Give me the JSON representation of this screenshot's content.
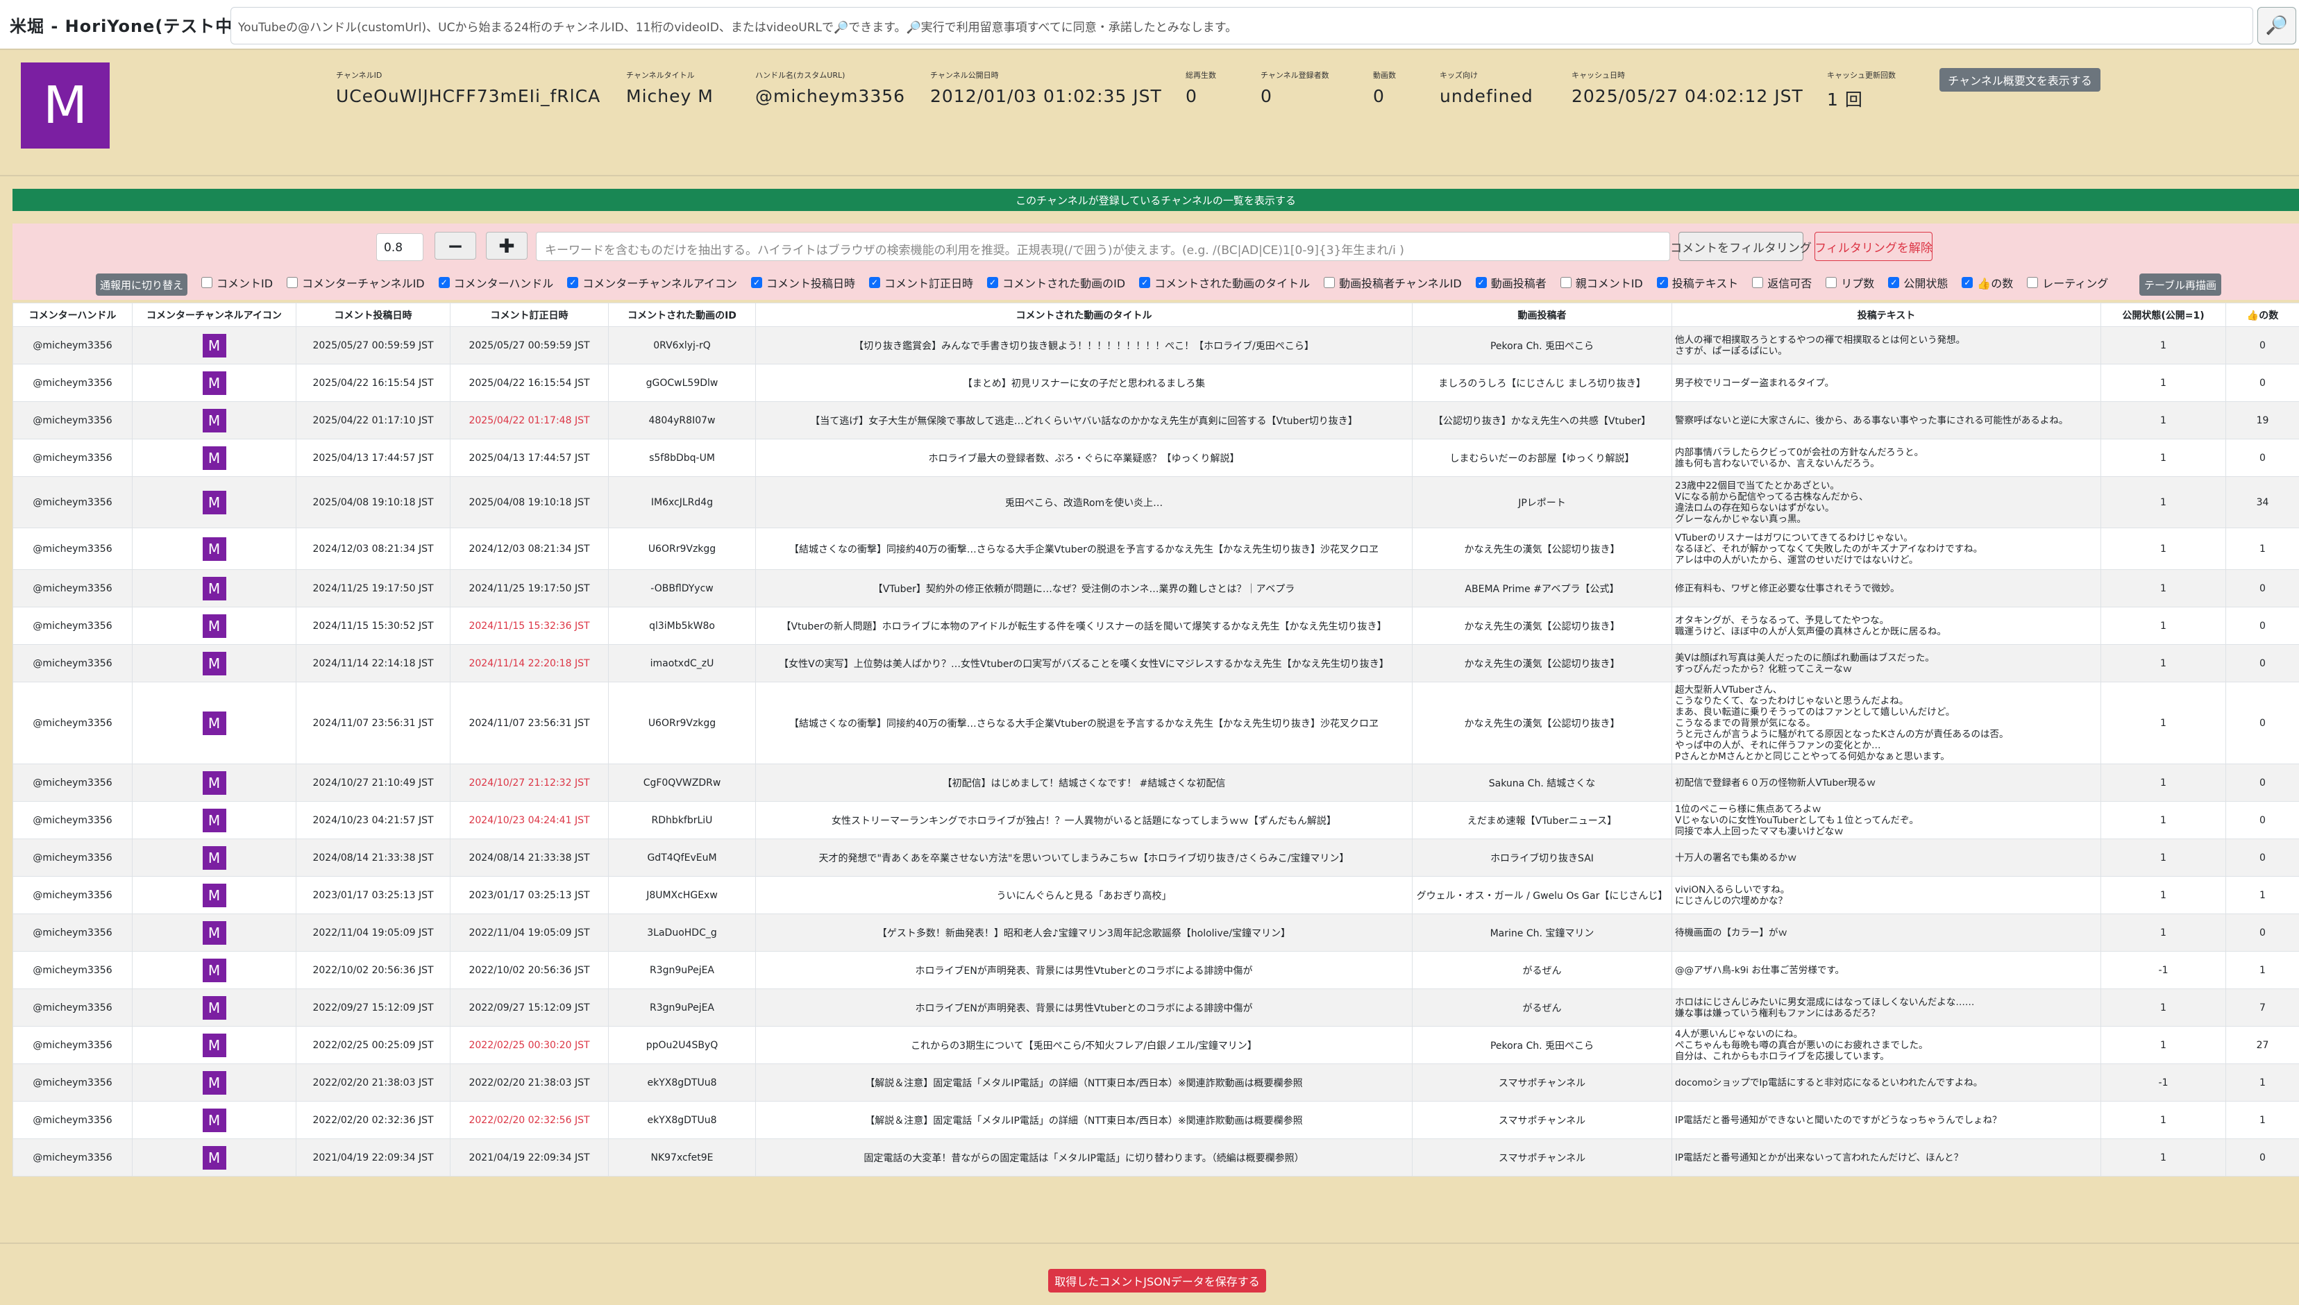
{
  "app_title": "米堀 - HoriYone(テスト中)",
  "search": {
    "text": "YouTubeの@ハンドル(customUrl)、UCから始まる24桁のチャンネルID、11桁のvideoID、またはvideoURLで🔎できます。🔎実行で利用留意事項すべてに同意・承諾したとみなします。",
    "btn": "🔎"
  },
  "channel": {
    "avatar_letter": "M",
    "fields": [
      {
        "label": "チャンネルID",
        "value": "UCeOuWlJHCFF73mEIi_fRlCA"
      },
      {
        "label": "チャンネルタイトル",
        "value": "Michey M"
      },
      {
        "label": "ハンドル名(カスタムURL)",
        "value": "@micheym3356"
      },
      {
        "label": "チャンネル公開日時",
        "value": "2012/01/03 01:02:35 JST"
      },
      {
        "label": "総再生数",
        "value": "0"
      },
      {
        "label": "チャンネル登録者数",
        "value": "0"
      },
      {
        "label": "動画数",
        "value": "0"
      },
      {
        "label": "キッズ向け",
        "value": "undefined"
      },
      {
        "label": "キャッシュ日時",
        "value": "2025/05/27 04:02:12 JST"
      },
      {
        "label": "キャッシュ更新回数",
        "value": "1 回"
      }
    ],
    "desc_btn": "チャンネル概要文を表示する"
  },
  "subs_bar": "このチャンネルが登録しているチャンネルの一覧を表示する",
  "filter": {
    "zoom": "0.8",
    "minus": "−",
    "plus": "✚",
    "keyword_placeholder": "キーワードを含むものだけを抽出する。ハイライトはブラウザの検索機能の利用を推奨。正規表現(/で囲う)が使えます。(e.g. /(BC|AD|CE)1[0-9]{3}年生まれ/i )",
    "apply": "コメントをフィルタリング",
    "clear": "フィルタリングを解除",
    "mode_btn": "通報用に切り替え",
    "redraw": "テーブル再描画",
    "columns": [
      {
        "label": "コメントID",
        "on": false
      },
      {
        "label": "コメンターチャンネルID",
        "on": false
      },
      {
        "label": "コメンターハンドル",
        "on": true
      },
      {
        "label": "コメンターチャンネルアイコン",
        "on": true
      },
      {
        "label": "コメント投稿日時",
        "on": true
      },
      {
        "label": "コメント訂正日時",
        "on": true
      },
      {
        "label": "コメントされた動画のID",
        "on": true
      },
      {
        "label": "コメントされた動画のタイトル",
        "on": true
      },
      {
        "label": "動画投稿者チャンネルID",
        "on": false
      },
      {
        "label": "動画投稿者",
        "on": true
      },
      {
        "label": "親コメントID",
        "on": false
      },
      {
        "label": "投稿テキスト",
        "on": true
      },
      {
        "label": "返信可否",
        "on": false
      },
      {
        "label": "リプ数",
        "on": false
      },
      {
        "label": "公開状態",
        "on": true
      },
      {
        "label": "👍の数",
        "on": true
      },
      {
        "label": "レーティング",
        "on": false
      }
    ]
  },
  "table": {
    "headers": [
      "コメンターハンドル",
      "コメンターチャンネルアイコン",
      "コメント投稿日時",
      "コメント訂正日時",
      "コメントされた動画のID",
      "コメントされた動画のタイトル",
      "動画投稿者",
      "投稿テキスト",
      "公開状態(公開=1)",
      "👍の数"
    ],
    "rows": [
      {
        "h": "@micheym3356",
        "a": "M",
        "p": "2025/05/27 00:59:59 JST",
        "e": "2025/05/27 00:59:59 JST",
        "er": false,
        "v": "0RV6xlyj-rQ",
        "t": "【切り抜き鑑賞会】みんなで手書き切り抜き観よう！！！！！！！！！ぺこ！【ホロライブ/兎田ぺこら】",
        "o": "Pekora Ch. 兎田ぺこら",
        "x": "他人の褌で相撲取ろうとするやつの褌で相撲取るとは何という発想。\nさすが、ぱーぽるぱにい。",
        "s": "1",
        "l": "0"
      },
      {
        "h": "@micheym3356",
        "a": "M",
        "p": "2025/04/22 16:15:54 JST",
        "e": "2025/04/22 16:15:54 JST",
        "er": false,
        "v": "gGOCwL59Dlw",
        "t": "【まとめ】初見リスナーに女の子だと思われるましろ集",
        "o": "ましろのうしろ【にじさんじ ましろ切り抜き】",
        "x": "男子校でリコーダー盗まれるタイプ。",
        "s": "1",
        "l": "0"
      },
      {
        "h": "@micheym3356",
        "a": "M",
        "p": "2025/04/22 01:17:10 JST",
        "e": "2025/04/22 01:17:48 JST",
        "er": true,
        "v": "4804yR8I07w",
        "t": "【当て逃げ】女子大生が無保険で事故して逃走…どれくらいヤバい話なのかかなえ先生が真剣に回答する【Vtuber切り抜き】",
        "o": "【公認切り抜き】かなえ先生への共感【Vtuber】",
        "x": "警察呼ばないと逆に大家さんに、後から、ある事ない事やった事にされる可能性があるよね。",
        "s": "1",
        "l": "19"
      },
      {
        "h": "@micheym3356",
        "a": "M",
        "p": "2025/04/13 17:44:57 JST",
        "e": "2025/04/13 17:44:57 JST",
        "er": false,
        "v": "s5f8bDbq-UM",
        "t": "ホロライブ最大の登録者数、ぷろ・ぐらに卒業疑惑？【ゆっくり解説】",
        "o": "しまむらいだーのお部屋【ゆっくり解説】",
        "x": "内部事情バラしたらクビって0が会社の方針なんだろうと。\n誰も何も言わないでいるか、言えないんだろう。",
        "s": "1",
        "l": "0"
      },
      {
        "h": "@micheym3356",
        "a": "M",
        "p": "2025/04/08 19:10:18 JST",
        "e": "2025/04/08 19:10:18 JST",
        "er": false,
        "v": "IM6xcJLRd4g",
        "t": "兎田ぺこら、改造Romを使い炎上…",
        "o": "JPレポート",
        "x": "23歳中22個目で当てたとかあざとい。\nVになる前から配信やってる古株なんだから、\n違法ロムの存在知らないはずがない。\nグレーなんかじゃない真っ黒。",
        "s": "1",
        "l": "34"
      },
      {
        "h": "@micheym3356",
        "a": "M",
        "p": "2024/12/03 08:21:34 JST",
        "e": "2024/12/03 08:21:34 JST",
        "er": false,
        "v": "U6ORr9Vzkgg",
        "t": "【結城さくなの衝撃】同接約40万の衝撃…さらなる大手企業Vtuberの脱退を予言するかなえ先生【かなえ先生切り抜き】沙花叉クロヱ",
        "o": "かなえ先生の漢気【公認切り抜き】",
        "x": "VTuberのリスナーはガワについてきてるわけじゃない。\nなるほど、それが解かってなくて失敗したのがキズナアイなわけですね。\nアレは中の人がいたから、運営のせいだけではないけど。",
        "s": "1",
        "l": "1"
      },
      {
        "h": "@micheym3356",
        "a": "M",
        "p": "2024/11/25 19:17:50 JST",
        "e": "2024/11/25 19:17:50 JST",
        "er": false,
        "v": "-OBBflDYycw",
        "t": "【VTuber】契約外の修正依頼が問題に…なぜ？受注側のホンネ…業界の難しさとは？｜アベプラ",
        "o": "ABEMA Prime #アベプラ【公式】",
        "x": "修正有料も、ワザと修正必要な仕事されそうで微妙。",
        "s": "1",
        "l": "0"
      },
      {
        "h": "@micheym3356",
        "a": "M",
        "p": "2024/11/15 15:30:52 JST",
        "e": "2024/11/15 15:32:36 JST",
        "er": true,
        "v": "ql3iMb5kW8o",
        "t": "【Vtuberの新人問題】ホロライブに本物のアイドルが転生する件を嘆くリスナーの話を聞いて爆笑するかなえ先生【かなえ先生切り抜き】",
        "o": "かなえ先生の漢気【公認切り抜き】",
        "x": "オタキングが、そうなるって、予見してたやつな。\n職運うけど、ほぼ中の人が人気声優の真林さんとか既に居るね。",
        "s": "1",
        "l": "0"
      },
      {
        "h": "@micheym3356",
        "a": "M",
        "p": "2024/11/14 22:14:18 JST",
        "e": "2024/11/14 22:20:18 JST",
        "er": true,
        "v": "imaotxdC_zU",
        "t": "【女性Vの実写】上位勢は美人ばかり？…女性Vtuberの口実写がバズることを嘆く女性Vにマジレスするかなえ先生【かなえ先生切り抜き】",
        "o": "かなえ先生の漢気【公認切り抜き】",
        "x": "美Vは顔ばれ写真は美人だったのに顔ばれ動画はブスだった。\nすっぴんだったから？化粧ってこえーなｗ",
        "s": "1",
        "l": "0"
      },
      {
        "h": "@micheym3356",
        "a": "M",
        "p": "2024/11/07 23:56:31 JST",
        "e": "2024/11/07 23:56:31 JST",
        "er": false,
        "v": "U6ORr9Vzkgg",
        "t": "【結城さくなの衝撃】同接約40万の衝撃…さらなる大手企業Vtuberの脱退を予言するかなえ先生【かなえ先生切り抜き】沙花叉クロヱ",
        "o": "かなえ先生の漢気【公認切り抜き】",
        "x": "超大型新人VTuberさん、\nこうなりたくて、なったわけじゃないと思うんだよね。\nまあ、良い転道に乗りそうってのはファンとして嬉しいんだけど。\nこうなるまでの背景が気になる。\nうと元さんが言うように騒がれてる原因となったKさんの方が責任あるのは否。\nやっぱ中の人が、それに伴うファンの変化とか…\nPさんとかMさんとかと同じことやってる何処かなぁと思います。",
        "s": "1",
        "l": "0"
      },
      {
        "h": "@micheym3356",
        "a": "M",
        "p": "2024/10/27 21:10:49 JST",
        "e": "2024/10/27 21:12:32 JST",
        "er": true,
        "v": "CgF0QVWZDRw",
        "t": "【初配信】はじめまして！結城さくなです！ #結城さくな初配信",
        "o": "Sakuna Ch. 結城さくな",
        "x": "初配信で登録者６０万の怪物新人VTuber現るｗ",
        "s": "1",
        "l": "0"
      },
      {
        "h": "@micheym3356",
        "a": "M",
        "p": "2024/10/23 04:21:57 JST",
        "e": "2024/10/23 04:24:41 JST",
        "er": true,
        "v": "RDhbkfbrLiU",
        "t": "女性ストリーマーランキングでホロライブが独占！？一人異物がいると話題になってしまうｗｗ【ずんだもん解説】",
        "o": "えだまめ速報【VTuberニュース】",
        "x": "1位のぺこーら様に焦点あてろよｗ\nVじゃないのに女性YouTuberとしても１位とってんだぞ。\n同接で本人上回ったママも凄いけどなｗ",
        "s": "1",
        "l": "0"
      },
      {
        "h": "@micheym3356",
        "a": "M",
        "p": "2024/08/14 21:33:38 JST",
        "e": "2024/08/14 21:33:38 JST",
        "er": false,
        "v": "GdT4QfEvEuM",
        "t": "天才的発想で\"青あくあを卒業させない方法\"を思いついてしまうみこちｗ【ホロライブ切り抜き/さくらみこ/宝鐘マリン】",
        "o": "ホロライブ切り抜きSAI",
        "x": "十万人の署名でも集めるかｗ",
        "s": "1",
        "l": "0"
      },
      {
        "h": "@micheym3356",
        "a": "M",
        "p": "2023/01/17 03:25:13 JST",
        "e": "2023/01/17 03:25:13 JST",
        "er": false,
        "v": "J8UMXcHGExw",
        "t": "ういにんぐらんと見る「あおぎり高校」",
        "o": "グウェル・オス・ガール / Gwelu Os Gar【にじさんじ】",
        "x": "viviON入るらしいですね。\nにじさんじの穴埋めかな？",
        "s": "1",
        "l": "1"
      },
      {
        "h": "@micheym3356",
        "a": "M",
        "p": "2022/11/04 19:05:09 JST",
        "e": "2022/11/04 19:05:09 JST",
        "er": false,
        "v": "3LaDuoHDC_g",
        "t": "【ゲスト多数！新曲発表！】昭和老人会♪宝鐘マリン3周年記念歌謡祭【hololive/宝鐘マリン】",
        "o": "Marine Ch. 宝鐘マリン",
        "x": "待機画面の【カラー】がｗ",
        "s": "1",
        "l": "0"
      },
      {
        "h": "@micheym3356",
        "a": "M",
        "p": "2022/10/02 20:56:36 JST",
        "e": "2022/10/02 20:56:36 JST",
        "er": false,
        "v": "R3gn9uPejEA",
        "t": "ホロライブENが声明発表、背景には男性Vtuberとのコラボによる誹謗中傷が",
        "o": "がるぜん",
        "x": "@@アザハ鳥-k9i お仕事ご苦労様です。",
        "s": "-1",
        "l": "1"
      },
      {
        "h": "@micheym3356",
        "a": "M",
        "p": "2022/09/27 15:12:09 JST",
        "e": "2022/09/27 15:12:09 JST",
        "er": false,
        "v": "R3gn9uPejEA",
        "t": "ホロライブENが声明発表、背景には男性Vtuberとのコラボによる誹謗中傷が",
        "o": "がるぜん",
        "x": "ホロはにじさんじみたいに男女混成にはなってほしくないんだよな……\n嫌な事は嫌っていう権利もファンにはあるだろ？",
        "s": "1",
        "l": "7"
      },
      {
        "h": "@micheym3356",
        "a": "M",
        "p": "2022/02/25 00:25:09 JST",
        "e": "2022/02/25 00:30:20 JST",
        "er": true,
        "v": "ppOu2U4SByQ",
        "t": "これからの3期生について【兎田ぺこら/不知火フレア/白銀ノエル/宝鐘マリン】",
        "o": "Pekora Ch. 兎田ぺこら",
        "x": "4人が悪いんじゃないのにね。\nぺこちゃんも毎晩も噂の真合が悪いのにお疲れさまでした。\n自分は、これからもホロライブを応援しています。",
        "s": "1",
        "l": "27"
      },
      {
        "h": "@micheym3356",
        "a": "M",
        "p": "2022/02/20 21:38:03 JST",
        "e": "2022/02/20 21:38:03 JST",
        "er": false,
        "v": "ekYX8gDTUu8",
        "t": "【解説＆注意】固定電話「メタルIP電話」の詳細（NTT東日本/西日本）※関連詐欺動画は概要欄参照",
        "o": "スマサポチャンネル",
        "x": "docomoショップでIp電話にすると非対応になるといわれたんですよね。",
        "s": "-1",
        "l": "1"
      },
      {
        "h": "@micheym3356",
        "a": "M",
        "p": "2022/02/20 02:32:36 JST",
        "e": "2022/02/20 02:32:56 JST",
        "er": true,
        "v": "ekYX8gDTUu8",
        "t": "【解説＆注意】固定電話「メタルIP電話」の詳細（NTT東日本/西日本）※関連詐欺動画は概要欄参照",
        "o": "スマサポチャンネル",
        "x": "IP電話だと番号通知ができないと聞いたのですがどうなっちゃうんでしょね？",
        "s": "1",
        "l": "1"
      },
      {
        "h": "@micheym3356",
        "a": "M",
        "p": "2021/04/19 22:09:34 JST",
        "e": "2021/04/19 22:09:34 JST",
        "er": false,
        "v": "NK97xcfet9E",
        "t": "固定電話の大変革！昔ながらの固定電話は「メタルIP電話」に切り替わります。（続編は概要欄参照）",
        "o": "スマサポチャンネル",
        "x": "IP電話だと番号通知とかが出来ないって言われたんだけど、ほんと？",
        "s": "1",
        "l": "0"
      }
    ]
  },
  "save_btn": "取得したコメントJSONデータを保存する"
}
